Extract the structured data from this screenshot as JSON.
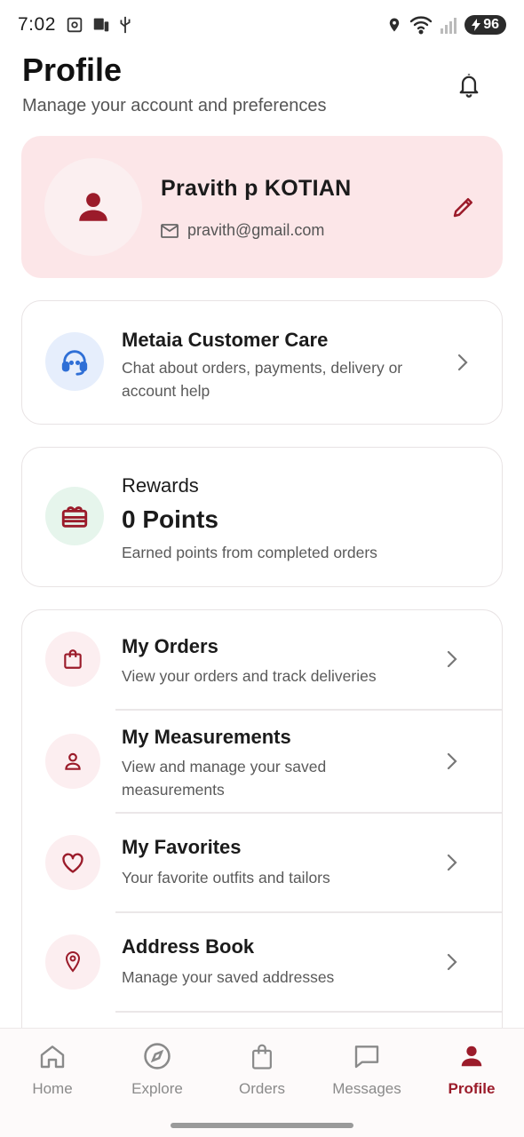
{
  "status_bar": {
    "time": "7:02",
    "battery": "96"
  },
  "header": {
    "title": "Profile",
    "subtitle": "Manage your account and preferences"
  },
  "profile": {
    "name": "Pravith p KOTIAN",
    "email": "pravith@gmail.com"
  },
  "customer_care": {
    "title": "Metaia Customer Care",
    "description": "Chat about orders, payments, delivery or account help"
  },
  "rewards": {
    "label": "Rewards",
    "points": "0 Points",
    "description": "Earned points from completed orders"
  },
  "menu": {
    "items": [
      {
        "title": "My Orders",
        "description": "View your orders and track deliveries"
      },
      {
        "title": "My Measurements",
        "description": "View and manage your saved measurements"
      },
      {
        "title": "My Favorites",
        "description": "Your favorite outfits and tailors"
      },
      {
        "title": "Address Book",
        "description": "Manage your saved addresses"
      }
    ]
  },
  "bottom_nav": {
    "items": [
      {
        "label": "Home"
      },
      {
        "label": "Explore"
      },
      {
        "label": "Orders"
      },
      {
        "label": "Messages"
      },
      {
        "label": "Profile"
      }
    ]
  },
  "colors": {
    "accent": "#9b1b2a",
    "profile_card_bg": "#fce6e8",
    "care_icon_bg": "#e6eefc",
    "rewards_icon_bg": "#e6f5ec"
  }
}
